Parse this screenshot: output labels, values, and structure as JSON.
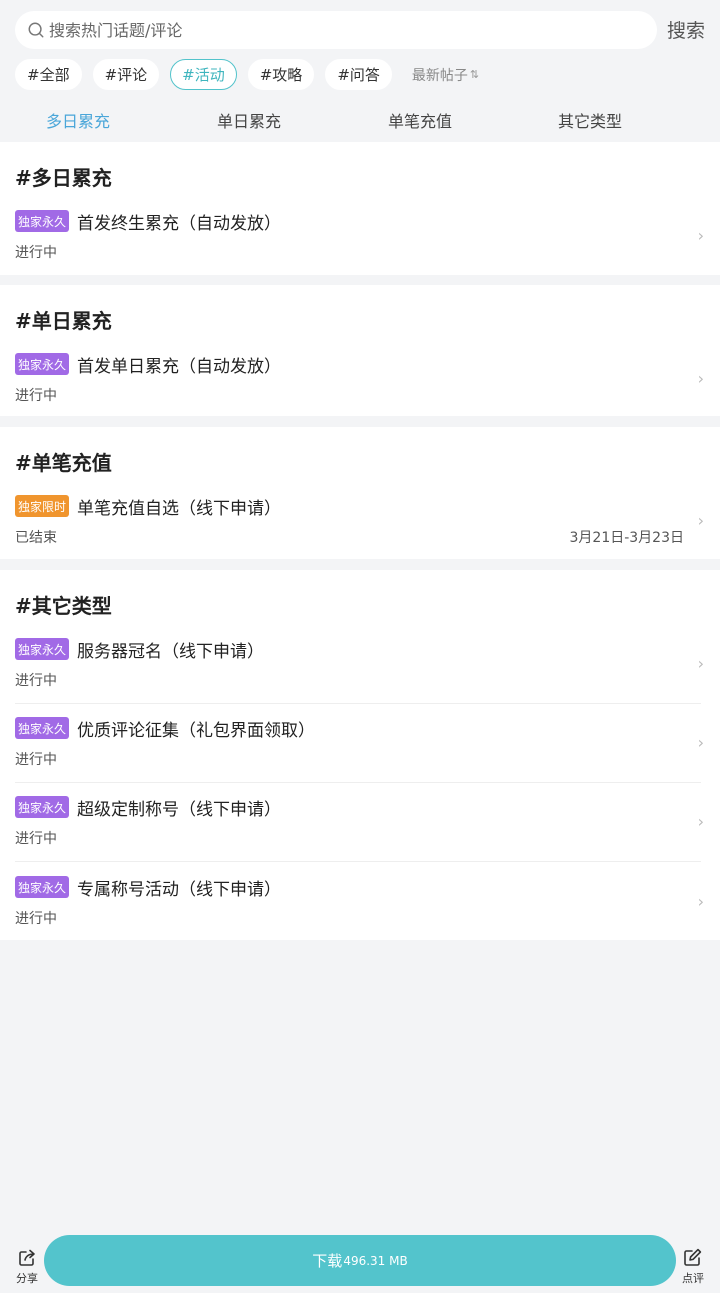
{
  "search": {
    "placeholder": "搜索热门话题/评论",
    "button_label": "搜索"
  },
  "tags": [
    {
      "label": "#全部"
    },
    {
      "label": "#评论"
    },
    {
      "label": "#活动",
      "active": true
    },
    {
      "label": "#攻略"
    },
    {
      "label": "#问答"
    }
  ],
  "sort": {
    "label": "最新帖子",
    "icon": "sort-arrows-icon"
  },
  "subtabs": [
    {
      "label": "多日累充",
      "active": true
    },
    {
      "label": "单日累充"
    },
    {
      "label": "单笔充值"
    },
    {
      "label": "其它类型"
    }
  ],
  "sections": [
    {
      "title": "#多日累充",
      "items": [
        {
          "badge": "独家永久",
          "title": "首发终生累充（自动发放）",
          "status": "进行中"
        }
      ]
    },
    {
      "title": "#单日累充",
      "items": [
        {
          "badge": "独家永久",
          "title": "首发单日累充（自动发放）",
          "status": "进行中"
        }
      ]
    },
    {
      "title": "#单笔充值",
      "items": [
        {
          "badge": "独家限时",
          "title": "单笔充值自选（线下申请）",
          "status": "已结束",
          "date": "3月21日-3月23日"
        }
      ]
    },
    {
      "title": "#其它类型",
      "items": [
        {
          "badge": "独家永久",
          "title": "服务器冠名（线下申请）",
          "status": "进行中"
        },
        {
          "badge": "独家永久",
          "title": "优质评论征集（礼包界面领取）",
          "status": "进行中"
        },
        {
          "badge": "独家永久",
          "title": "超级定制称号（线下申请）",
          "status": "进行中"
        },
        {
          "badge": "独家永久",
          "title": "专属称号活动（线下申请）",
          "status": "进行中"
        }
      ]
    }
  ],
  "bottom": {
    "share_label": "分享",
    "download_label": "下载",
    "download_size": "496.31 MB",
    "review_label": "点评"
  },
  "colors": {
    "accent": "#53c4cc",
    "tab_active": "#4aa6d9",
    "badge_permanent": "#a16ae6",
    "badge_limited": "#f0952e"
  }
}
